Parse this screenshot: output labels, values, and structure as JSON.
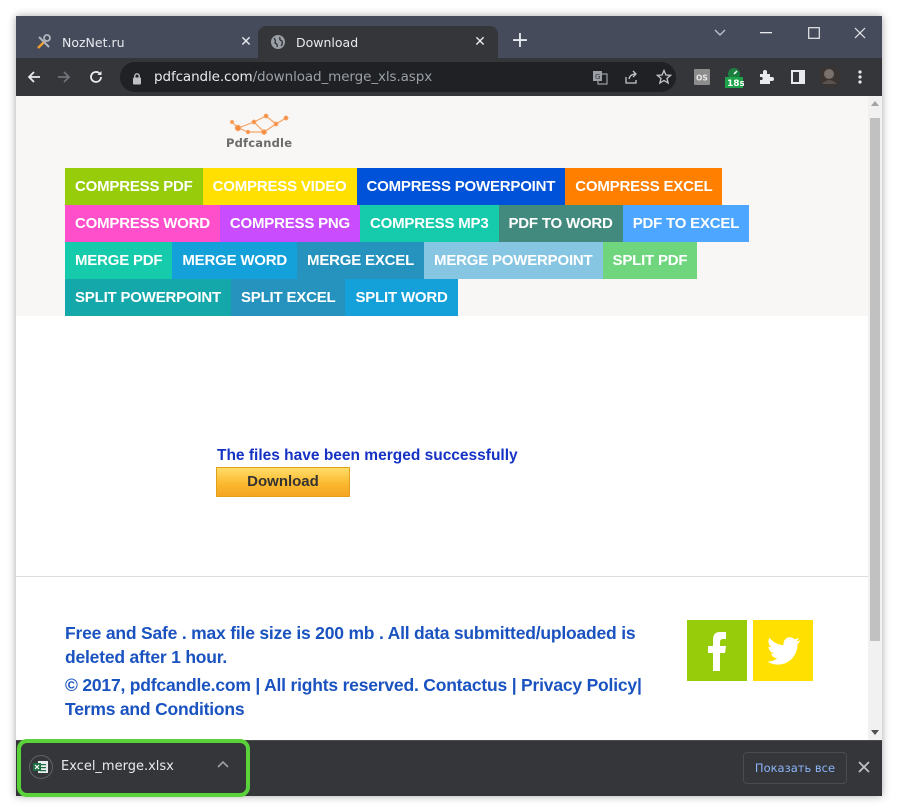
{
  "browser": {
    "tabs": [
      {
        "title": "NozNet.ru",
        "icon": "tools-icon",
        "active": false
      },
      {
        "title": "Download",
        "icon": "globe-icon",
        "active": true
      }
    ],
    "new_tab": "+",
    "url": {
      "host": "pdfcandle.com",
      "path": "/download_merge_xls.aspx"
    },
    "extension_badge": "18s"
  },
  "page": {
    "logo_text": "Pdfcandle",
    "menu_rows": [
      [
        {
          "label": "COMPRESS PDF",
          "color": "#97cc0b"
        },
        {
          "label": "COMPRESS VIDEO",
          "color": "#ffe000"
        },
        {
          "label": "COMPRESS POWERPOINT",
          "color": "#0052d9"
        },
        {
          "label": "COMPRESS EXCEL",
          "color": "#ff7f00"
        }
      ],
      [
        {
          "label": "COMPRESS WORD",
          "color": "#ff4fcb"
        },
        {
          "label": "COMPRESS PNG",
          "color": "#c94dff"
        },
        {
          "label": "COMPRESS MP3",
          "color": "#15cbab"
        },
        {
          "label": "PDF TO WORD",
          "color": "#438a7e"
        },
        {
          "label": "PDF TO EXCEL",
          "color": "#4da6ff"
        }
      ],
      [
        {
          "label": "MERGE PDF",
          "color": "#15cbab"
        },
        {
          "label": "MERGE WORD",
          "color": "#14a0d9"
        },
        {
          "label": "MERGE EXCEL",
          "color": "#2593bd"
        },
        {
          "label": "MERGE POWERPOINT",
          "color": "#87c6e2"
        },
        {
          "label": "SPLIT PDF",
          "color": "#6fd67e"
        }
      ],
      [
        {
          "label": "SPLIT POWERPOINT",
          "color": "#15a8ab"
        },
        {
          "label": "SPLIT EXCEL",
          "color": "#2593bd"
        },
        {
          "label": "SPLIT WORD",
          "color": "#14a0d9"
        }
      ]
    ],
    "success_message": "The files have been merged successfully",
    "download_button": "Download",
    "footer": {
      "line1": "Free and Safe . max file size is 200 mb . All data submitted/uploaded is deleted after 1 hour.",
      "line2": "© 2017, pdfcandle.com | All rights reserved. Contactus | Privacy Policy| Terms and Conditions"
    },
    "social": [
      {
        "name": "facebook",
        "color": "#97cc0b"
      },
      {
        "name": "twitter",
        "color": "#ffe000"
      }
    ]
  },
  "download_bar": {
    "file_name": "Excel_merge.xlsx",
    "show_all": "Показать все"
  }
}
